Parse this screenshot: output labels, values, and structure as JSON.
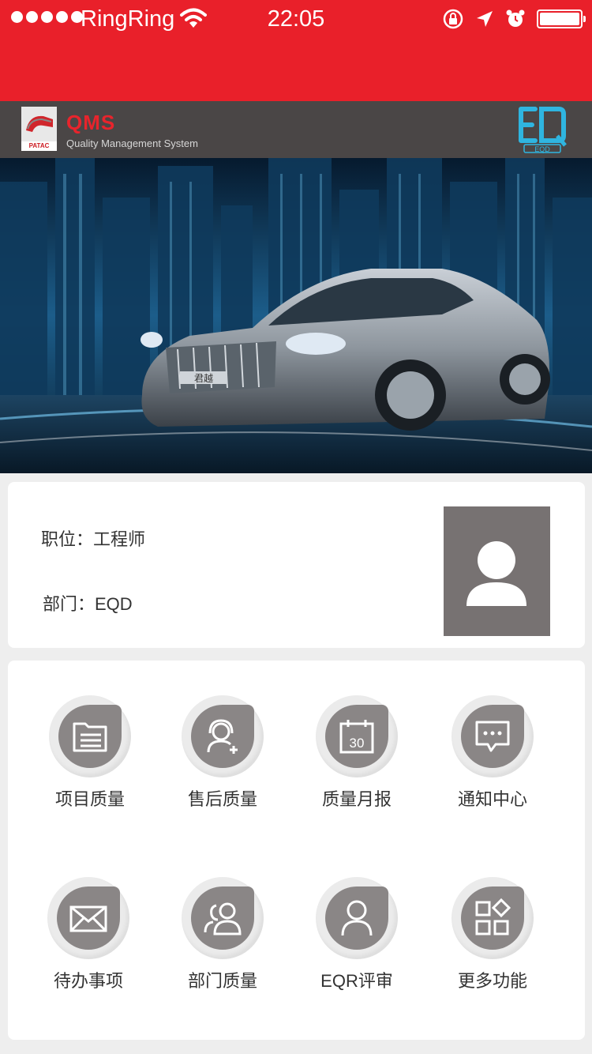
{
  "status_bar": {
    "carrier": "RingRing",
    "time": "22:05"
  },
  "header": {
    "brand_small": "PATAC",
    "title": "QMS",
    "subtitle": "Quality Management System",
    "right_logo_text": "EQD"
  },
  "banner": {
    "plate_text": "君越"
  },
  "profile": {
    "position_label": "职位：工程师",
    "department_label": "部门：EQD",
    "avatar_icon": "person-icon"
  },
  "features": [
    {
      "label": "项目质量",
      "icon": "folder-list-icon"
    },
    {
      "label": "售后质量",
      "icon": "headset-user-icon"
    },
    {
      "label": "质量月报",
      "icon": "calendar-30-icon"
    },
    {
      "label": "通知中心",
      "icon": "chat-bubble-icon"
    },
    {
      "label": "待办事项",
      "icon": "envelope-icon"
    },
    {
      "label": "部门质量",
      "icon": "users-icon"
    },
    {
      "label": "EQR评审",
      "icon": "user-icon"
    },
    {
      "label": "更多功能",
      "icon": "apps-grid-icon"
    }
  ],
  "colors": {
    "status_bar": "#e9202a",
    "header": "#4a4646",
    "brand_red": "#e8242c",
    "eqd_blue": "#2fb5e0",
    "icon_gray": "#8a8686"
  }
}
